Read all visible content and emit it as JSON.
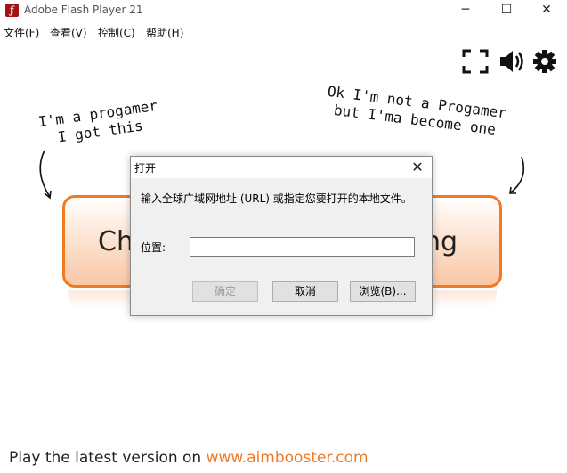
{
  "window": {
    "title": "Adobe Flash Player 21",
    "icon": "flash-icon"
  },
  "controls": {
    "minimize": "─",
    "maximize": "☐",
    "close": "✕"
  },
  "menu": [
    {
      "label": "文件(F)"
    },
    {
      "label": "查看(V)"
    },
    {
      "label": "控制(C)"
    },
    {
      "label": "帮助(H)"
    }
  ],
  "toolbar": {
    "icons": [
      "fullscreen-icon",
      "speaker-icon",
      "gear-icon"
    ]
  },
  "stage": {
    "note_left": [
      "I'm a progamer",
      "I got this"
    ],
    "note_right": [
      "Ok I'm not a Progamer",
      "but I'ma become one"
    ],
    "big_button_left": "Ch",
    "big_button_right": "ng",
    "footer_text": "Play the latest version on ",
    "footer_link": "www.aimbooster.com",
    "accent": "#f07a22"
  },
  "dialog": {
    "title": "打开",
    "close": "✕",
    "message": "输入全球广域网地址 (URL) 或指定您要打开的本地文件。",
    "location_label": "位置:",
    "location_value": "",
    "ok": "确定",
    "cancel": "取消",
    "browse": "浏览(B)..."
  }
}
